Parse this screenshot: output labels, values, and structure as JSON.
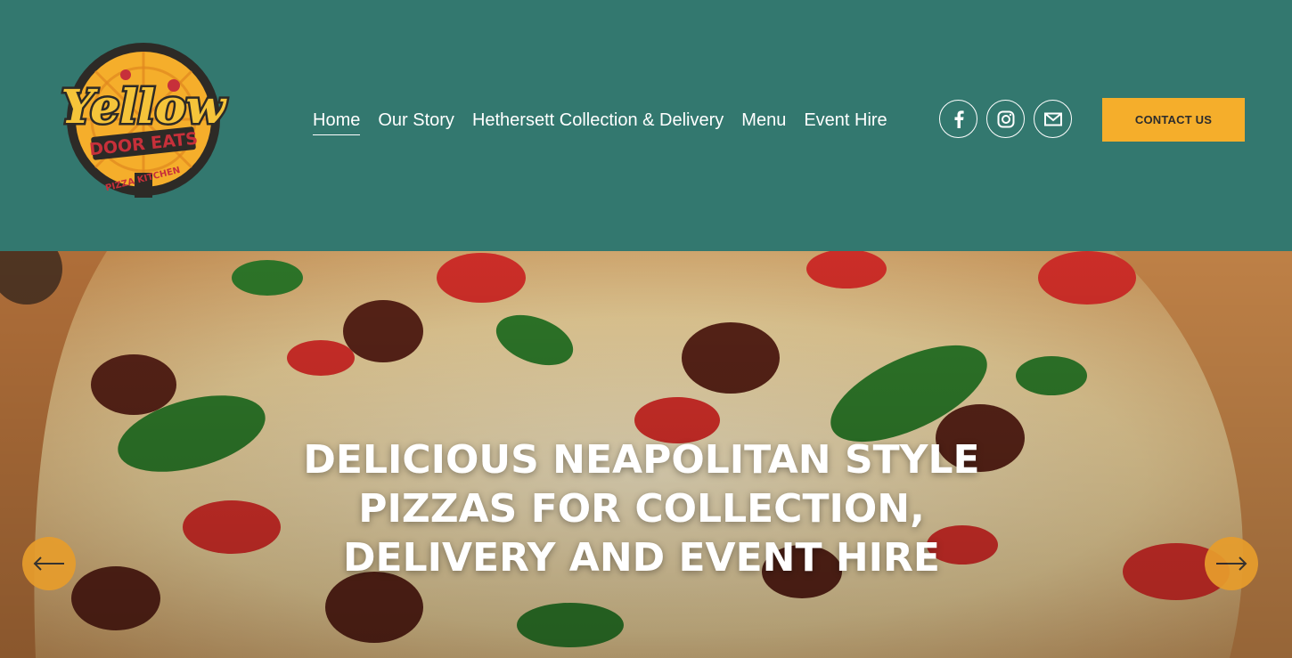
{
  "logo": {
    "line1": "Yellow",
    "line2": "DOOR EATS",
    "line3": "PIZZA KITCHEN"
  },
  "nav": [
    {
      "label": "Home",
      "active": true
    },
    {
      "label": "Our Story",
      "active": false
    },
    {
      "label": "Hethersett Collection & Delivery",
      "active": false
    },
    {
      "label": "Menu",
      "active": false
    },
    {
      "label": "Event Hire",
      "active": false
    }
  ],
  "social": [
    {
      "icon": "facebook-icon"
    },
    {
      "icon": "instagram-icon"
    },
    {
      "icon": "email-icon"
    }
  ],
  "contact_button": "CONTACT US",
  "hero": {
    "title": "DELICIOUS NEAPOLITAN STYLE PIZZAS FOR COLLECTION, DELIVERY AND EVENT HIRE",
    "prev_icon": "arrow-left-icon",
    "next_icon": "arrow-right-icon"
  },
  "colors": {
    "header_bg": "#33786f",
    "accent": "#f5ae2b",
    "arrow": "#e79d2c",
    "text": "#ffffff"
  }
}
